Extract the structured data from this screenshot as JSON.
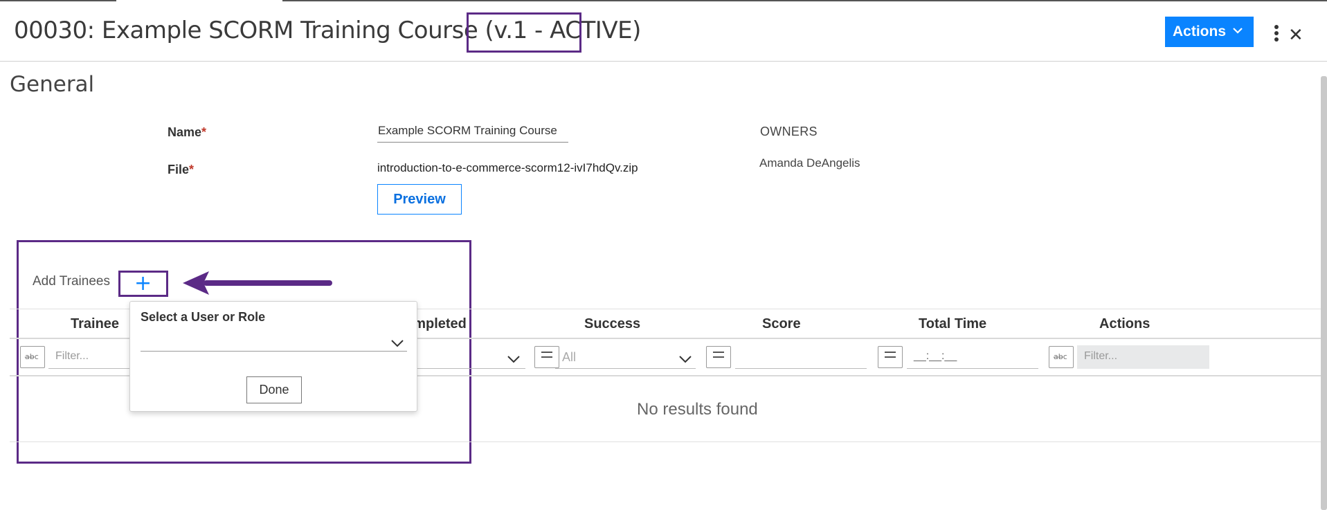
{
  "header": {
    "title": "00030: Example SCORM Training Course (v.1 - ACTIVE)",
    "actions_label": "Actions",
    "accent_color": "#0a84ff",
    "annotation_color": "#5b2a86"
  },
  "general": {
    "section_title": "General",
    "name_label": "Name",
    "name_value": "Example SCORM Training Course",
    "file_label": "File",
    "file_value": "introduction-to-e-commerce-scorm12-ivI7hdQv.zip",
    "preview_label": "Preview",
    "required_mark": "*",
    "owners_heading": "OWNERS",
    "owner_name": "Amanda DeAngelis"
  },
  "trainees": {
    "add_label": "Add Trainees",
    "add_icon": "+",
    "columns": [
      "Trainee",
      "ompleted",
      "Success",
      "Score",
      "Total Time",
      "Actions"
    ],
    "trainee_filter_placeholder": "Filter...",
    "success_filter_value": "All",
    "time_placeholder": "__:__:__",
    "actions_filter_placeholder": "Filter...",
    "empty_message": "No results found"
  },
  "popup": {
    "label": "Select a User or Role",
    "done_label": "Done"
  }
}
